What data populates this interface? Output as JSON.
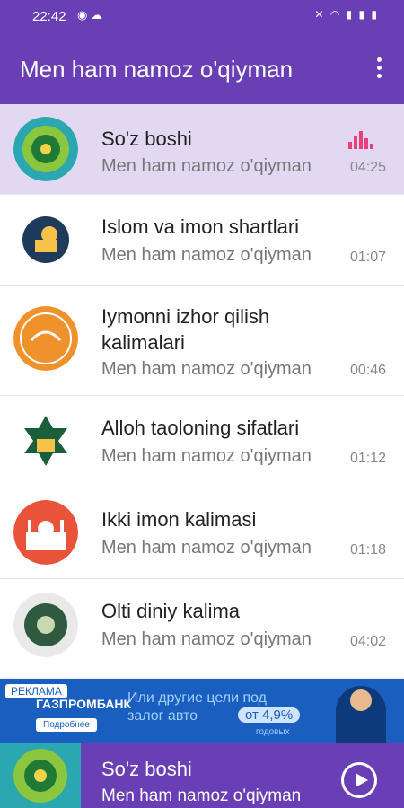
{
  "status": {
    "time": "22:42",
    "left_icons": "◉ ☁",
    "right_icons": "✕ ◠ ▮ ▮ ▮"
  },
  "app": {
    "title": "Men ham namoz o'qiyman"
  },
  "tracks": [
    {
      "title": "So'z boshi",
      "artist": "Men ham namoz o'qiyman",
      "duration": "04:25",
      "active": true
    },
    {
      "title": "Islom va imon shartlari",
      "artist": "Men ham namoz o'qiyman",
      "duration": "01:07"
    },
    {
      "title": "Iymonni izhor qilish kalimalari",
      "artist": "Men ham namoz o'qiyman",
      "duration": "00:46"
    },
    {
      "title": "Alloh taoloning sifatlari",
      "artist": "Men ham namoz o'qiyman",
      "duration": "01:12"
    },
    {
      "title": "Ikki imon kalimasi",
      "artist": "Men ham namoz o'qiyman",
      "duration": "01:18"
    },
    {
      "title": "Olti diniy kalima",
      "artist": "Men ham namoz o'qiyman",
      "duration": "04:02"
    }
  ],
  "ad": {
    "tag": "РЕКЛАМА",
    "brand": "ГАЗПРОМБАНК",
    "button": "Подробнее",
    "text": "Или другие цели под залог авто",
    "rate": "от 4,9%",
    "small": "годовых"
  },
  "player": {
    "title": "So'z boshi",
    "artist": "Men ham namoz o'qiyman"
  },
  "colors": {
    "primary": "#6a3fb5",
    "active_row": "#e2d8f2",
    "eq": "#e8407a"
  }
}
